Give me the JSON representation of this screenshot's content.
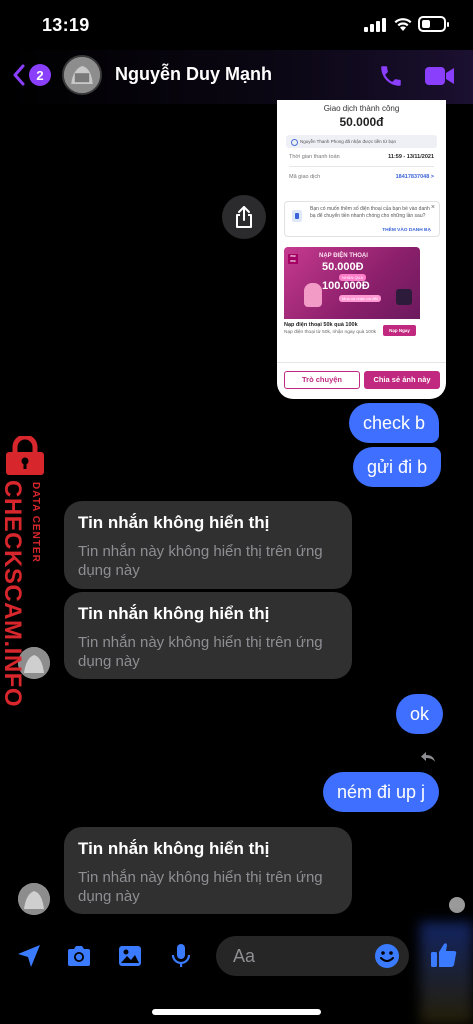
{
  "status_bar": {
    "time": "13:19"
  },
  "header": {
    "back_count": "2",
    "contact_name": "Nguyễn Duy Mạnh"
  },
  "shared_image": {
    "title": "Giao dịch thành công",
    "amount": "50.000đ",
    "note": "Nguyễn Thanh Phong đã nhận được tiền từ bạn",
    "time_label": "Thời gian thanh toán",
    "time_value": "11:59 - 13/11/2021",
    "code_label": "Mã giao dịch",
    "code_value": "18417837048 >",
    "contact_text": "Bạn có muốn thêm số điện thoại của bạn bè vào danh bạ để chuyển tiền nhanh chóng cho những lần sau?",
    "contact_close": "×",
    "contact_link": "THÊM VÀO DANH BẠ",
    "promo_logo": "mo mo",
    "promo_line1": "NẠP ĐIỆN THOẠI",
    "promo_line2": "50.000Đ",
    "promo_line3": "NHẬN QUÀ",
    "promo_line4": "100.000Đ",
    "promo_line5": "Mua và nhận ưu đãi",
    "promo_title": "Nạp điện thoại 50k quà 100k",
    "promo_desc": "Nạp điện thoại từ 50k, nhận ngay quà 100k",
    "promo_button": "Nạp Ngay",
    "chat_button": "Trò chuyện",
    "share_button": "Chia sẻ ảnh này"
  },
  "messages": {
    "out1": "check b",
    "out2": "gửi đi b",
    "in1_title": "Tin nhắn không hiển thị",
    "in1_body": "Tin nhắn này không hiển thị trên ứng dụng này",
    "in2_title": "Tin nhắn không hiển thị",
    "in2_body": "Tin nhắn này không hiển thị trên ứng dụng này",
    "out3": "ok",
    "out4": "ném đi up j",
    "in3_title": "Tin nhắn không hiển thị",
    "in3_body": "Tin nhắn này không hiển thị trên ứng dụng này"
  },
  "watermark": {
    "main": "CHECKSCAM.INFO",
    "sub": "DATA CENTER"
  },
  "composer": {
    "placeholder": "Aa"
  },
  "colors": {
    "accent": "#8a3ffc",
    "bubble_out": "#3f6fff",
    "bubble_in": "#303030",
    "watermark": "#d7262c"
  }
}
